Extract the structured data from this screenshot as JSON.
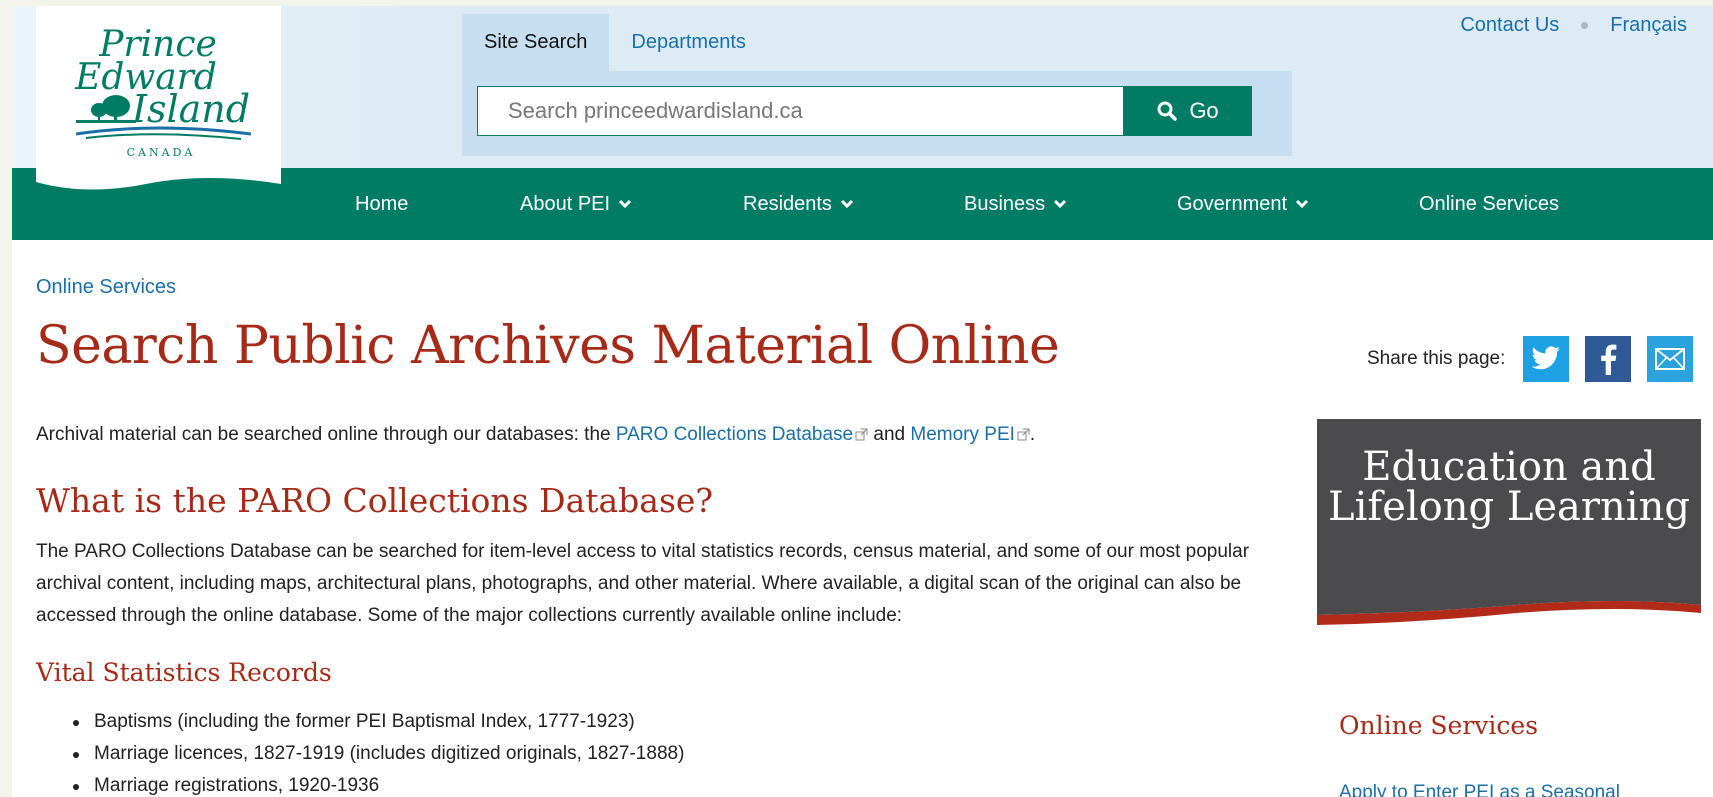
{
  "header": {
    "logo": {
      "line1": "Prince",
      "line2": "Edward",
      "line3": "Island",
      "country": "CANADA"
    },
    "search": {
      "tabs": [
        {
          "label": "Site Search",
          "active": true
        },
        {
          "label": "Departments",
          "active": false
        }
      ],
      "placeholder": "Search princeedwardisland.ca",
      "go_label": "Go"
    },
    "top_links": {
      "contact": "Contact Us",
      "french": "Français"
    },
    "nav": [
      {
        "label": "Home",
        "has_dropdown": false
      },
      {
        "label": "About PEI",
        "has_dropdown": true
      },
      {
        "label": "Residents",
        "has_dropdown": true
      },
      {
        "label": "Business",
        "has_dropdown": true
      },
      {
        "label": "Government",
        "has_dropdown": true
      },
      {
        "label": "Online Services",
        "has_dropdown": false
      }
    ]
  },
  "main": {
    "breadcrumb": "Online Services",
    "title": "Search Public Archives Material Online",
    "intro": {
      "before": "Archival material can be searched online through our databases: the ",
      "link1": "PARO Collections Database",
      "middle": " and ",
      "link2": "Memory PEI",
      "after": "."
    },
    "section_heading": "What is the PARO Collections Database?",
    "section_text": "The PARO Collections Database can be searched for item-level access to vital statistics records, census material, and some of our most popular archival content, including maps, architectural plans, photographs, and other material. Where available, a digital scan of the original can also be accessed through the online database. Some of the major collections currently available online include:",
    "subheading": "Vital Statistics Records",
    "list": [
      "Baptisms (including the former PEI Baptismal Index, 1777-1923)",
      "Marriage licences, 1827-1919 (includes digitized originals, 1827-1888)",
      "Marriage registrations, 1920-1936"
    ]
  },
  "sidebar": {
    "share_label": "Share this page:",
    "share_icons": [
      "twitter-icon",
      "facebook-icon",
      "email-icon"
    ],
    "banner_title": "Education and Lifelong Learning",
    "heading": "Online Services",
    "link": "Apply to Enter PEI as a Seasonal"
  },
  "colors": {
    "brand_green": "#007c64",
    "heading_red": "#a52a17",
    "link_blue": "#1a6fa8",
    "header_blue": "#dcebf4",
    "banner_grey": "#4b4b4d"
  }
}
